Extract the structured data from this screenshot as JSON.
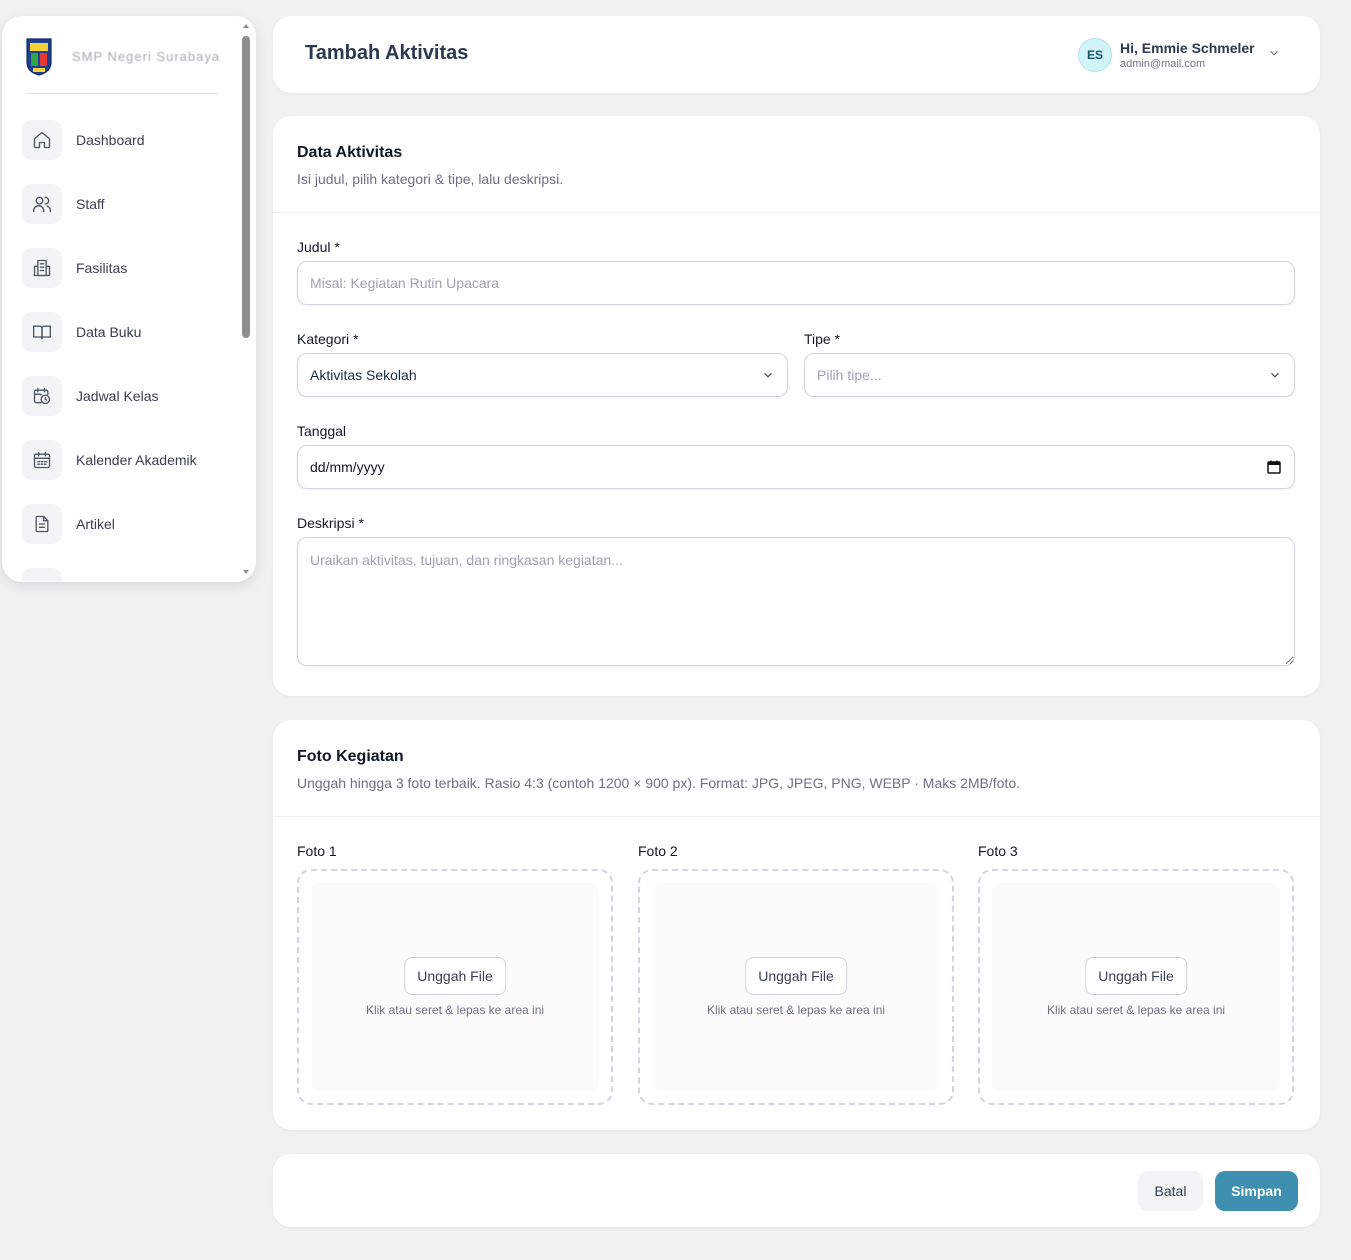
{
  "brand": {
    "name": "SMP Negeri Surabaya"
  },
  "sidebar": {
    "items": [
      {
        "label": "Dashboard",
        "icon": "home-icon"
      },
      {
        "label": "Staff",
        "icon": "users-icon"
      },
      {
        "label": "Fasilitas",
        "icon": "building-icon"
      },
      {
        "label": "Data Buku",
        "icon": "book-icon"
      },
      {
        "label": "Jadwal Kelas",
        "icon": "calendar-clock-icon"
      },
      {
        "label": "Kalender Akademik",
        "icon": "calendar-icon"
      },
      {
        "label": "Artikel",
        "icon": "document-icon"
      }
    ]
  },
  "header": {
    "title": "Tambah Aktivitas",
    "user": {
      "initials": "ES",
      "greeting": "Hi, Emmie Schmeler",
      "email": "admin@mail.com"
    }
  },
  "data_section": {
    "title": "Data Aktivitas",
    "subtitle": "Isi judul, pilih kategori & tipe, lalu deskripsi.",
    "judul": {
      "label": "Judul *",
      "placeholder": "Misal: Kegiatan Rutin Upacara",
      "value": ""
    },
    "kategori": {
      "label": "Kategori *",
      "value": "Aktivitas Sekolah"
    },
    "tipe": {
      "label": "Tipe *",
      "placeholder": "Pilih tipe..."
    },
    "tanggal": {
      "label": "Tanggal",
      "value": "dd/mm/yyyy"
    },
    "deskripsi": {
      "label": "Deskripsi *",
      "placeholder": "Uraikan aktivitas, tujuan, dan ringkasan kegiatan..."
    }
  },
  "photo_section": {
    "title": "Foto Kegiatan",
    "subtitle": "Unggah hingga 3 foto terbaik. Rasio 4:3 (contoh 1200 × 900 px). Format: JPG, JPEG, PNG, WEBP · Maks 2MB/foto.",
    "slots": [
      {
        "label": "Foto 1",
        "button": "Unggah File",
        "hint": "Klik atau seret & lepas ke area ini"
      },
      {
        "label": "Foto 2",
        "button": "Unggah File",
        "hint": "Klik atau seret & lepas ke area ini"
      },
      {
        "label": "Foto 3",
        "button": "Unggah File",
        "hint": "Klik atau seret & lepas ke area ini"
      }
    ]
  },
  "footer": {
    "cancel_label": "Batal",
    "save_label": "Simpan"
  },
  "colors": {
    "accent": "#3e8fb0",
    "avatar_bg": "#d2f4f8",
    "page_bg": "#f1f1f2"
  }
}
